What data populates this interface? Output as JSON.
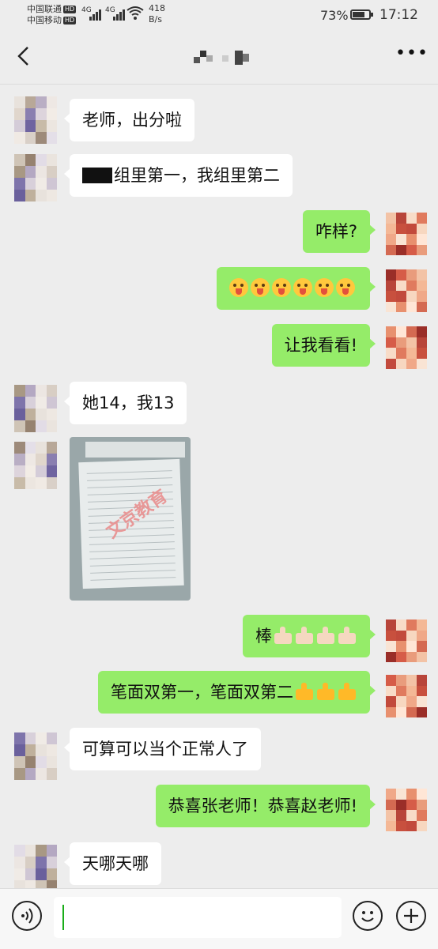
{
  "status_bar": {
    "carrier1": "中国联通",
    "carrier2": "中国移动",
    "hd_badge": "HD",
    "net1": "4G",
    "net2": "4G",
    "speed_value": "418",
    "speed_unit": "B/s",
    "battery": "73%",
    "battery_level": 0.73,
    "time": "17:12"
  },
  "header": {
    "back_icon": "chevron-left-icon",
    "more_icon": "ellipsis-icon"
  },
  "messages": [
    {
      "side": "left",
      "text": "老师，出分啦"
    },
    {
      "side": "left",
      "text": "组里第一，我组里第二"
    },
    {
      "side": "right",
      "text": "咋样?"
    },
    {
      "side": "right",
      "emoji": "tongue-out-emoji",
      "emoji_count": 6
    },
    {
      "side": "right",
      "text": "让我看看!"
    },
    {
      "side": "left",
      "text": "她14，我13"
    },
    {
      "side": "left",
      "type": "image",
      "watermark": "文京教育"
    },
    {
      "side": "right",
      "text": "棒",
      "emoji": "thumbs-up-emoji",
      "emoji_count": 4
    },
    {
      "side": "right",
      "text": "笔面双第一，笔面双第二",
      "emoji": "thumbs-up-emoji",
      "emoji_count": 3
    },
    {
      "side": "left",
      "text": "可算可以当个正常人了"
    },
    {
      "side": "right",
      "text": "恭喜张老师！恭喜赵老师!"
    },
    {
      "side": "left",
      "text": "天哪天哪"
    }
  ],
  "bottom_bar": {
    "input_value": "",
    "voice_icon": "voice-icon",
    "emoji_icon": "smiley-icon",
    "plus_icon": "plus-icon"
  },
  "colors": {
    "background": "#ededed",
    "bubble_self": "#95ec69",
    "bubble_other": "#ffffff"
  }
}
